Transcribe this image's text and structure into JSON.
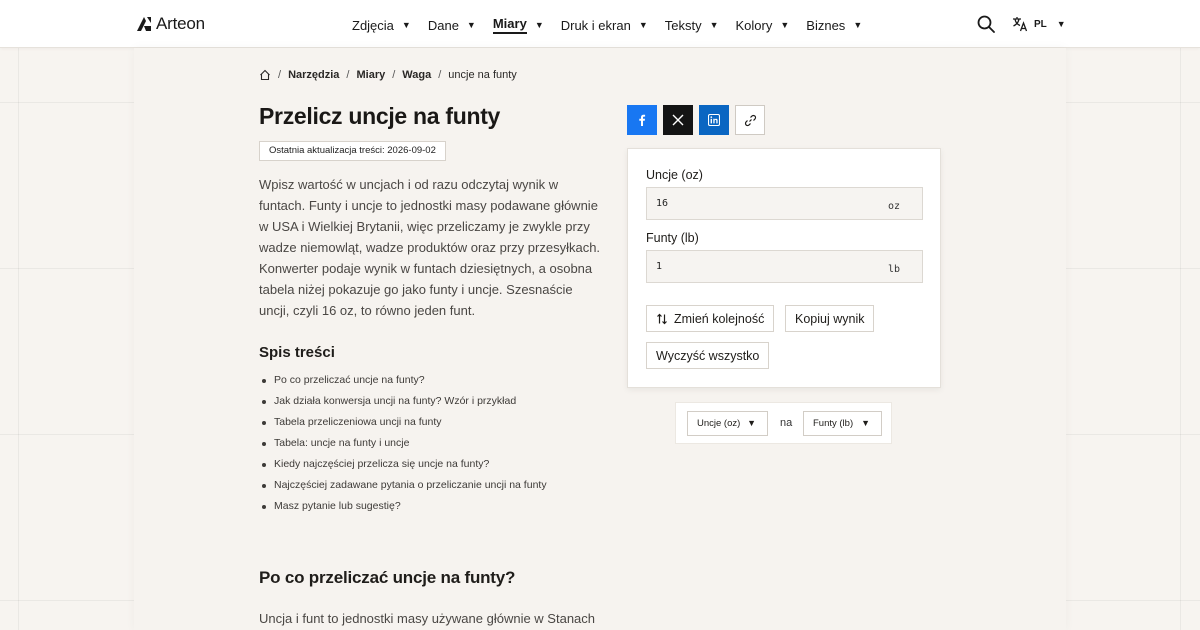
{
  "header": {
    "logo_text": "Arteon",
    "nav": [
      {
        "label": "Zdjęcia"
      },
      {
        "label": "Dane"
      },
      {
        "label": "Miary"
      },
      {
        "label": "Druk i ekran"
      },
      {
        "label": "Teksty"
      },
      {
        "label": "Kolory"
      },
      {
        "label": "Biznes"
      }
    ],
    "active_nav": "Miary",
    "lang": "PL"
  },
  "breadcrumb": {
    "items": [
      "Narzędzia",
      "Miary",
      "Waga"
    ],
    "current": "uncje na funty"
  },
  "page": {
    "title": "Przelicz uncje na funty",
    "updated": "Ostatnia aktualizacja treści: 2026-09-02",
    "intro": "Wpisz wartość w uncjach i od razu odczytaj wynik w funtach. Funty i uncje to jednostki masy podawane głównie w USA i Wielkiej Brytanii, więc przeliczamy je zwykle przy wadze niemowląt, wadze produktów oraz przy przesyłkach. Konwerter podaje wynik w funtach dziesiętnych, a osobna tabela niżej pokazuje go jako funty i uncje. Szesnaście uncji, czyli 16 oz, to równo jeden funt.",
    "toc_title": "Spis treści",
    "toc": [
      "Po co przeliczać uncje na funty?",
      "Jak działa konwersja uncji na funty? Wzór i przykład",
      "Tabela przeliczeniowa uncji na funty",
      "Tabela: uncje na funty i uncje",
      "Kiedy najczęściej przelicza się uncje na funty?",
      "Najczęściej zadawane pytania o przeliczanie uncji na funty",
      "Masz pytanie lub sugestię?"
    ],
    "section_title": "Po co przeliczać uncje na funty?",
    "section_text": "Uncja i funt to jednostki masy używane głównie w Stanach"
  },
  "converter": {
    "from_label": "Uncje (oz)",
    "from_value": "16",
    "from_unit": "oz",
    "to_label": "Funty (lb)",
    "to_value": "1",
    "to_unit": "lb",
    "swap_label": "Zmień kolejność",
    "copy_label": "Kopiuj wynik",
    "clear_label": "Wyczyść wszystko"
  },
  "unit_bar": {
    "from_select": "Uncje (oz)",
    "na": "na",
    "to_select": "Funty (lb)"
  },
  "colors": {
    "facebook": "#1877f2",
    "x": "#141414",
    "linkedin": "#0a66c2"
  }
}
